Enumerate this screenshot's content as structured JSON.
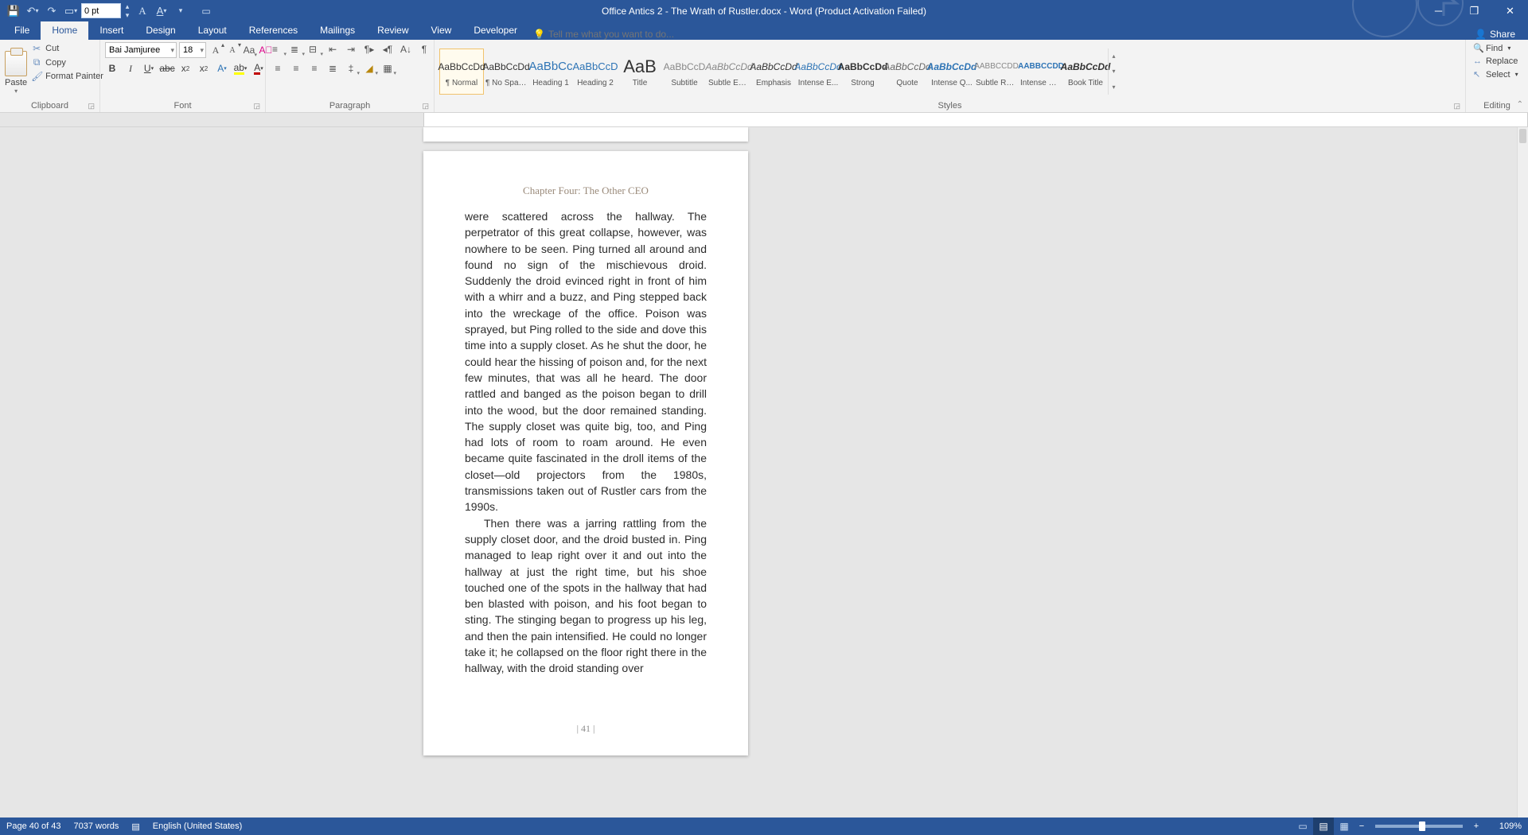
{
  "app": {
    "title": "Office Antics 2 - The Wrath of Rustler.docx - Word (Product Activation Failed)"
  },
  "qat": {
    "spacing_value": "0 pt"
  },
  "tabs": {
    "items": [
      "File",
      "Home",
      "Insert",
      "Design",
      "Layout",
      "References",
      "Mailings",
      "Review",
      "View",
      "Developer"
    ],
    "active_index": 1,
    "tellme_placeholder": "Tell me what you want to do...",
    "share_label": "Share"
  },
  "ribbon": {
    "clipboard": {
      "label": "Clipboard",
      "paste": "Paste",
      "cut": "Cut",
      "copy": "Copy",
      "format_painter": "Format Painter"
    },
    "font": {
      "label": "Font",
      "name": "Bai Jamjuree",
      "size": "18"
    },
    "paragraph": {
      "label": "Paragraph"
    },
    "styles": {
      "label": "Styles",
      "items": [
        {
          "sample": "AaBbCcDd",
          "name": "¶ Normal",
          "css": "color:#333;"
        },
        {
          "sample": "AaBbCcDd",
          "name": "¶ No Spac...",
          "css": "color:#333;"
        },
        {
          "sample": "AaBbCc",
          "name": "Heading 1",
          "css": "color:#2e74b5;font-size:15px;"
        },
        {
          "sample": "AaBbCcD",
          "name": "Heading 2",
          "css": "color:#2e74b5;font-size:13px;"
        },
        {
          "sample": "AaB",
          "name": "Title",
          "css": "color:#333;font-size:22px;"
        },
        {
          "sample": "AaBbCcD",
          "name": "Subtitle",
          "css": "color:#888;"
        },
        {
          "sample": "AaBbCcDd",
          "name": "Subtle Em...",
          "css": "color:#888;font-style:italic;"
        },
        {
          "sample": "AaBbCcDd",
          "name": "Emphasis",
          "css": "color:#333;font-style:italic;"
        },
        {
          "sample": "AaBbCcDd",
          "name": "Intense E...",
          "css": "color:#2e74b5;font-style:italic;"
        },
        {
          "sample": "AaBbCcDd",
          "name": "Strong",
          "css": "color:#333;font-weight:bold;"
        },
        {
          "sample": "AaBbCcDd",
          "name": "Quote",
          "css": "color:#666;font-style:italic;"
        },
        {
          "sample": "AaBbCcDd",
          "name": "Intense Q...",
          "css": "color:#2e74b5;font-style:italic;font-weight:bold;"
        },
        {
          "sample": "AABBCCDD",
          "name": "Subtle Ref...",
          "css": "color:#888;font-size:10px;"
        },
        {
          "sample": "AABBCCDD",
          "name": "Intense Re...",
          "css": "color:#2e74b5;font-size:10px;font-weight:bold;"
        },
        {
          "sample": "AaBbCcDd",
          "name": "Book Title",
          "css": "color:#333;font-style:italic;font-weight:bold;"
        }
      ],
      "selected_index": 0
    },
    "editing": {
      "label": "Editing",
      "find": "Find",
      "replace": "Replace",
      "select": "Select"
    }
  },
  "document": {
    "header": "Chapter Four: The Other CEO",
    "para1": "were scattered across the hallway. The perpetrator of this great collapse, however, was nowhere to be seen. Ping turned all around and found no sign of the mischievous droid. Suddenly the droid evinced right in front of him with a whirr and a buzz, and Ping stepped back into the wreckage of the office. Poison was sprayed, but Ping rolled to the side and dove this time into a supply closet. As he shut the door, he could hear the hissing of poison and, for the next few minutes, that was all he heard. The door rattled and banged as the poison began to drill into the wood, but the door remained standing. The supply closet was quite big, too, and Ping had lots of room to roam around. He even became quite fascinated in the droll items of the closet—old projectors from the 1980s, transmissions taken out of Rustler cars from the 1990s.",
    "para2": "Then there was a jarring rattling from the supply closet door, and the droid busted in. Ping managed to leap right over it and out into the hallway at just the right time, but his shoe touched one of the spots in the hallway that had ben blasted with poison, and his foot began to sting. The stinging began to progress up his leg, and then the pain intensified. He could no longer take it; he collapsed on the floor right there in the hallway, with the droid standing over",
    "page_number": "| 41 |"
  },
  "status": {
    "page": "Page 40 of 43",
    "words": "7037 words",
    "language": "English (United States)",
    "zoom": "109%"
  }
}
